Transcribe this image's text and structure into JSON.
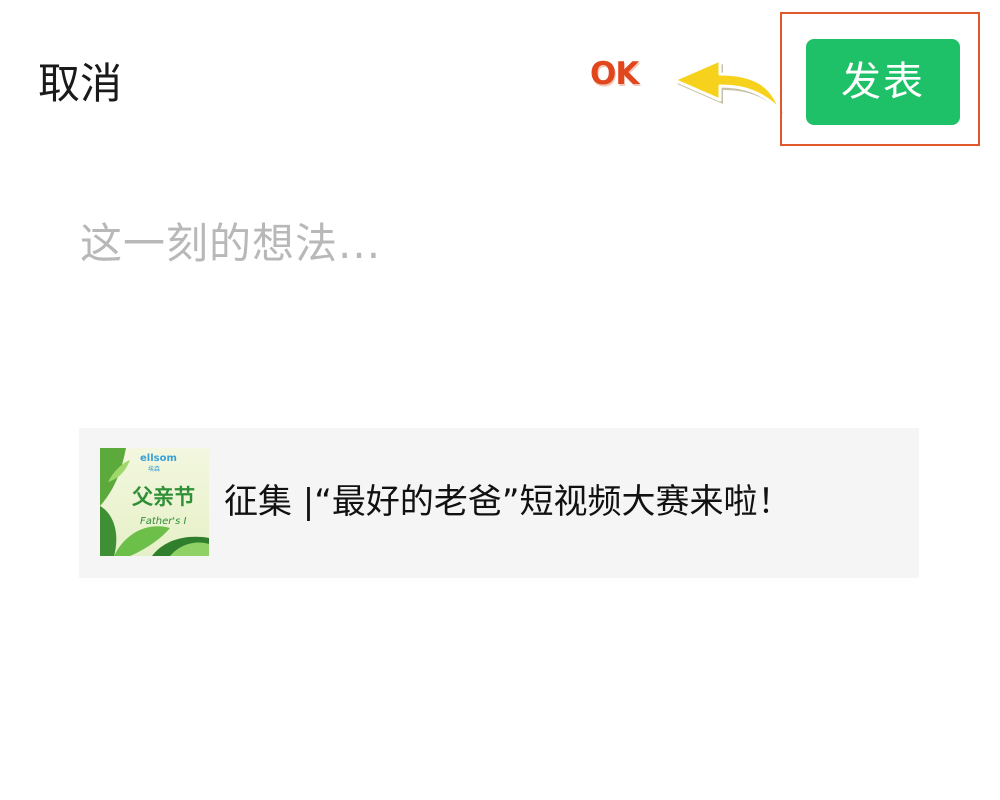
{
  "header": {
    "cancel_label": "取消",
    "publish_label": "发表"
  },
  "annotation": {
    "ok_text": "OK",
    "arrow_icon": "curved-arrow-left-icon",
    "arrow_color": "#f6d21c",
    "highlight_color": "#e0582b"
  },
  "compose": {
    "placeholder": "这一刻的想法..."
  },
  "shared_article": {
    "title": "征集 |“最好的老爸”短视频大赛来啦！",
    "thumbnail": {
      "logo_text": "ellsom",
      "logo_subtext": "埃森",
      "heading": "父亲节",
      "subheading": "Father's I"
    }
  },
  "colors": {
    "publish_green": "#1ec168",
    "placeholder_gray": "#b8b8b8",
    "card_background": "#f5f5f5"
  }
}
